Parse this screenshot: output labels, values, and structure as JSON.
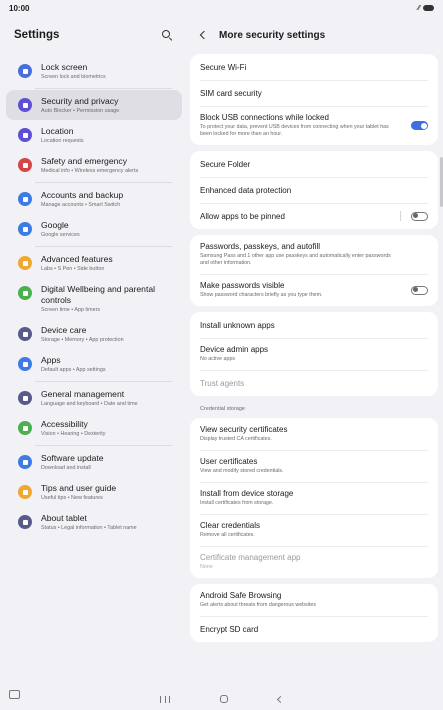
{
  "status": {
    "time": "10:00"
  },
  "left": {
    "title": "Settings",
    "groups": [
      [
        {
          "title": "Lock screen",
          "sub": "Screen lock and biometrics",
          "icon": "lock-icon",
          "color": "#4a6fdc"
        }
      ],
      [
        {
          "title": "Security and privacy",
          "sub": "Auto Blocker  •  Permission usage",
          "icon": "shield-icon",
          "color": "#5d4fd6"
        },
        {
          "title": "Location",
          "sub": "Location requests",
          "icon": "location-icon",
          "color": "#5d4fd6"
        },
        {
          "title": "Safety and emergency",
          "sub": "Medical info  •  Wireless emergency alerts",
          "icon": "emergency-icon",
          "color": "#d64545"
        }
      ],
      [
        {
          "title": "Accounts and backup",
          "sub": "Manage accounts  •  Smart Switch",
          "icon": "sync-icon",
          "color": "#3d7be6"
        },
        {
          "title": "Google",
          "sub": "Google services",
          "icon": "google-icon",
          "color": "#3d7be6"
        }
      ],
      [
        {
          "title": "Advanced features",
          "sub": "Labs  •  S Pen  •  Side button",
          "icon": "gear-plus-icon",
          "color": "#f0a833"
        },
        {
          "title": "Digital Wellbeing and parental controls",
          "sub": "Screen time  •  App timers",
          "icon": "wellbeing-icon",
          "color": "#4caf50"
        },
        {
          "title": "Device care",
          "sub": "Storage  •  Memory  •  App protection",
          "icon": "device-care-icon",
          "color": "#5a5a8a"
        },
        {
          "title": "Apps",
          "sub": "Default apps  •  App settings",
          "icon": "apps-icon",
          "color": "#3d7be6"
        }
      ],
      [
        {
          "title": "General management",
          "sub": "Language and keyboard  •  Date and time",
          "icon": "sliders-icon",
          "color": "#5a5a8a"
        },
        {
          "title": "Accessibility",
          "sub": "Vision  •  Hearing  •  Dexterity",
          "icon": "accessibility-icon",
          "color": "#4caf50"
        }
      ],
      [
        {
          "title": "Software update",
          "sub": "Download and install",
          "icon": "update-icon",
          "color": "#3d7be6"
        },
        {
          "title": "Tips and user guide",
          "sub": "Useful tips  •  New features",
          "icon": "bulb-icon",
          "color": "#f0a833"
        },
        {
          "title": "About tablet",
          "sub": "Status  •  Legal information  •  Tablet name",
          "icon": "info-icon",
          "color": "#5a5a8a"
        }
      ]
    ]
  },
  "right": {
    "title": "More security settings",
    "cards": [
      [
        {
          "title": "Secure Wi-Fi"
        },
        {
          "title": "SIM card security"
        },
        {
          "title": "Block USB connections while locked",
          "sub": "To protect your data, prevent USB devices from connecting when your tablet has been locked for more than an hour.",
          "toggle": "on"
        }
      ],
      [
        {
          "title": "Secure Folder"
        },
        {
          "title": "Enhanced data protection"
        },
        {
          "title": "Allow apps to be pinned",
          "toggle": "off",
          "divider": true
        }
      ],
      [
        {
          "title": "Passwords, passkeys, and autofill",
          "sub": "Samsung Pass and 1 other app use passkeys and automatically enter passwords and other information."
        },
        {
          "title": "Make passwords visible",
          "sub": "Show password characters briefly as you type them.",
          "toggle": "off"
        }
      ],
      [
        {
          "title": "Install unknown apps"
        },
        {
          "title": "Device admin apps",
          "sub": "No active apps"
        },
        {
          "title": "Trust agents",
          "disabled": true
        }
      ]
    ],
    "section_label": "Credential storage",
    "cards2": [
      [
        {
          "title": "View security certificates",
          "sub": "Display trusted CA certificates."
        },
        {
          "title": "User certificates",
          "sub": "View and modify stored credentials."
        },
        {
          "title": "Install from device storage",
          "sub": "Install certificates from storage."
        },
        {
          "title": "Clear credentials",
          "sub": "Remove all certificates."
        },
        {
          "title": "Certificate management app",
          "sub": "None",
          "disabled": true
        }
      ],
      [
        {
          "title": "Android Safe Browsing",
          "sub": "Get alerts about threats from dangerous websites"
        },
        {
          "title": "Encrypt SD card"
        }
      ]
    ]
  }
}
